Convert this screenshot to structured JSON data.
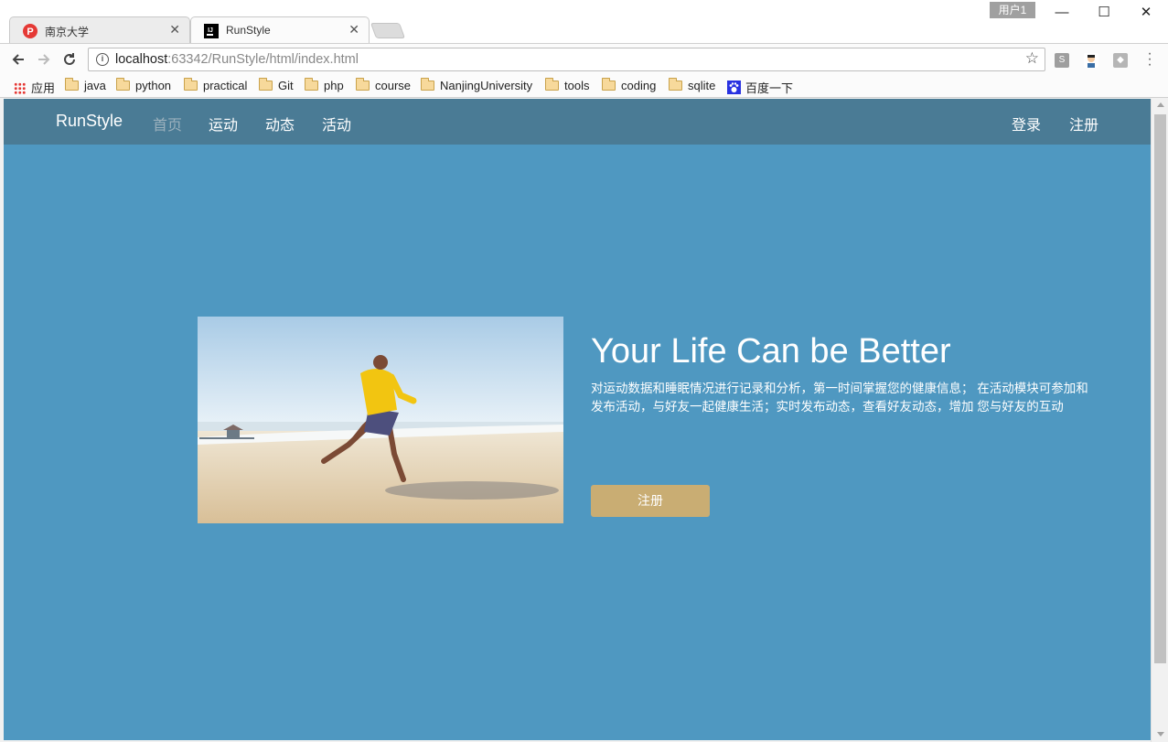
{
  "browser": {
    "user_badge": "用户1",
    "tabs": [
      {
        "title": "南京大学",
        "close": "✕"
      },
      {
        "title": "RunStyle",
        "close": "✕"
      }
    ],
    "window_controls": {
      "minimize": "—",
      "maximize": "☐",
      "close": "✕"
    },
    "omnibox": {
      "host": "localhost",
      "path": ":63342/RunStyle/html/index.html"
    },
    "bookmarks": [
      "应用",
      "java",
      "python",
      "practical",
      "Git",
      "php",
      "course",
      "NanjingUniversity",
      "tools",
      "coding",
      "sqlite",
      "百度一下"
    ],
    "extensions": [
      "S",
      "◆"
    ]
  },
  "site": {
    "brand": "RunStyle",
    "nav": [
      "首页",
      "运动",
      "动态",
      "活动"
    ],
    "auth": {
      "login": "登录",
      "register": "注册"
    },
    "hero": {
      "title": "Your Life Can be Better",
      "description": "对运动数据和睡眠情况进行记录和分析，第一时间掌握您的健康信息； 在活动模块可参加和发布活动，与好友一起健康生活；实时发布动态，查看好友动态，增加 您与好友的互动",
      "button": "注册"
    }
  },
  "colors": {
    "page_bg": "#4f98c1",
    "nav_bg": "#4a7b95",
    "button_bg": "#c9ad73"
  }
}
